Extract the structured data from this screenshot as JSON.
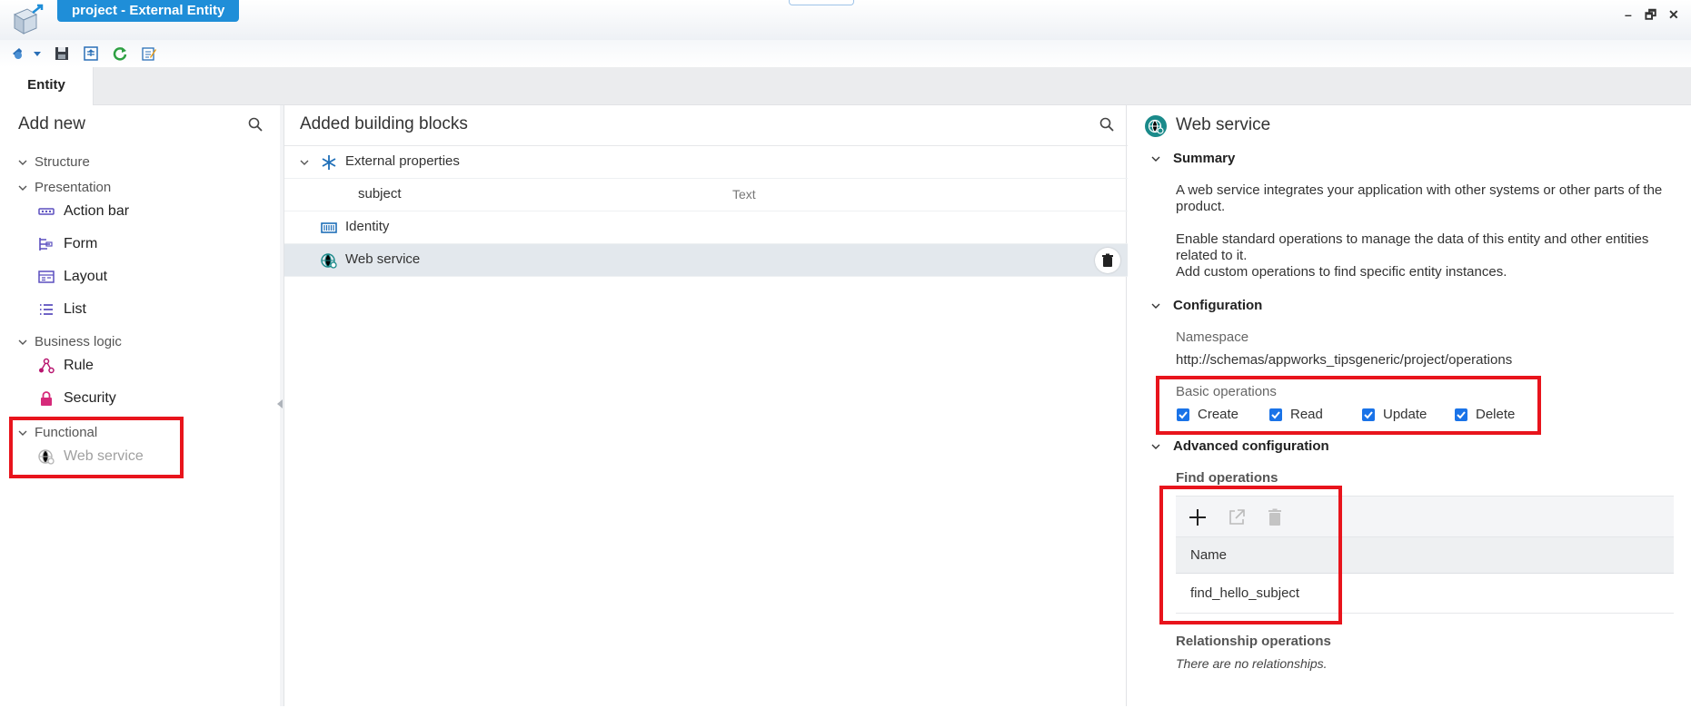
{
  "window": {
    "title": "project - External Entity",
    "controls": {
      "minimize": "–",
      "restore": "🗗",
      "close": "✕"
    }
  },
  "toolbar": {
    "icons": [
      "entity-menu-icon",
      "dropdown-icon",
      "save-icon",
      "publish-icon",
      "refresh-icon",
      "edit-icon"
    ]
  },
  "tabs": [
    {
      "label": "Entity"
    }
  ],
  "left": {
    "title": "Add new",
    "groups": [
      {
        "label": "Structure",
        "items": []
      },
      {
        "label": "Presentation",
        "items": [
          {
            "label": "Action bar"
          },
          {
            "label": "Form"
          },
          {
            "label": "Layout"
          },
          {
            "label": "List"
          }
        ]
      },
      {
        "label": "Business logic",
        "items": [
          {
            "label": "Rule"
          },
          {
            "label": "Security"
          }
        ]
      },
      {
        "label": "Functional",
        "items": [
          {
            "label": "Web service"
          }
        ]
      }
    ]
  },
  "middle": {
    "title": "Added building blocks",
    "rows": [
      {
        "label": "External properties"
      },
      {
        "label": "subject",
        "type": "Text"
      },
      {
        "label": "Identity"
      },
      {
        "label": "Web service"
      }
    ]
  },
  "right": {
    "title": "Web service",
    "summary": {
      "heading": "Summary",
      "para1": "A web service integrates your application with other systems or other parts of the product.",
      "para2a": "Enable standard operations to manage the data of this entity and other entities related to it.",
      "para2b": "Add custom operations to find specific entity instances."
    },
    "configuration": {
      "heading": "Configuration",
      "namespace_label": "Namespace",
      "namespace_value": "http://schemas/appworks_tipsgeneric/project/operations",
      "basic_ops_label": "Basic operations",
      "ops": [
        {
          "label": "Create",
          "checked": true
        },
        {
          "label": "Read",
          "checked": true
        },
        {
          "label": "Update",
          "checked": true
        },
        {
          "label": "Delete",
          "checked": true
        }
      ]
    },
    "advanced": {
      "heading": "Advanced configuration",
      "find_ops_label": "Find operations",
      "column_name": "Name",
      "find_rows": [
        "find_hello_subject"
      ],
      "relationship_label": "Relationship operations",
      "relationship_empty": "There are no relationships."
    }
  },
  "colors": {
    "accent": "#1f8ed8",
    "checkbox": "#1a73e8",
    "highlight": "#e8141c"
  }
}
